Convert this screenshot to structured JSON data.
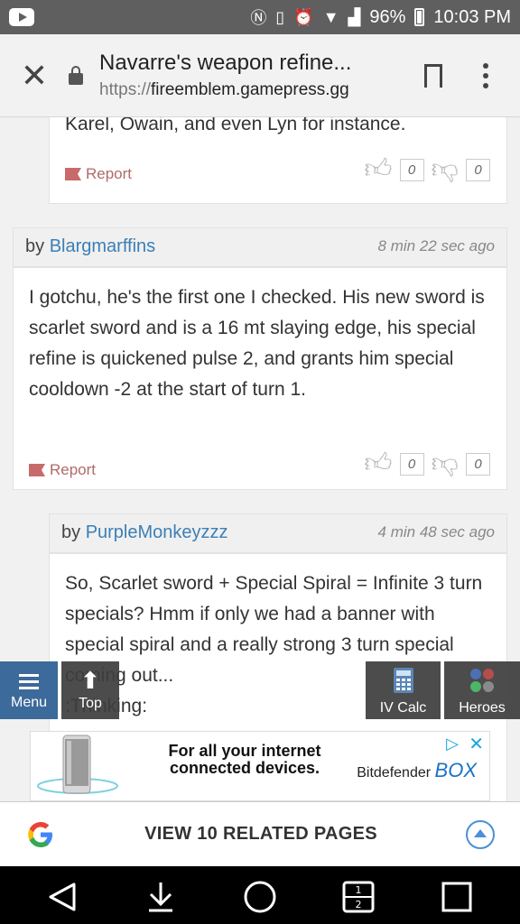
{
  "status_bar": {
    "battery": "96%",
    "time": "10:03 PM"
  },
  "browser": {
    "page_title": "Navarre's weapon refine...",
    "url_scheme": "https://",
    "url_host": "fireemblem.gamepress.gg"
  },
  "comments": [
    {
      "body": "Karel, Owain, and even Lyn for instance.",
      "report_label": "Report",
      "likes": "0",
      "dislikes": "0"
    },
    {
      "by_label": "by",
      "user": "Blargmarffins",
      "time": "8 min 22 sec ago",
      "body": "I gotchu, he's the first one I checked. His new sword is scarlet sword and is a 16 mt slaying edge, his special refine is quickened pulse 2, and grants him special cooldown -2 at the start of turn 1.",
      "report_label": "Report",
      "likes": "0",
      "dislikes": "0"
    },
    {
      "by_label": "by",
      "user": "PurpleMonkeyzzz",
      "time": "4 min 48 sec ago",
      "body": "So, Scarlet sword + Special Spiral = Infinite 3 turn specials? Hmm if only we had a banner with special spiral and a really strong 3 turn special coming out...\n:Thinking:"
    }
  ],
  "floating_buttons": {
    "menu": "Menu",
    "top": "Top",
    "iv_calc": "IV Calc",
    "heroes": "Heroes"
  },
  "ad": {
    "headline": "For all your internet connected devices.",
    "brand": "Bitdefender",
    "brand_product": "BOX"
  },
  "related": {
    "label": "VIEW 10 RELATED PAGES"
  },
  "colors": {
    "link": "#3b7fb6",
    "report": "#b06a6a",
    "float_blue": "#3c6a9a",
    "float_dark": "#3d3d3d"
  }
}
